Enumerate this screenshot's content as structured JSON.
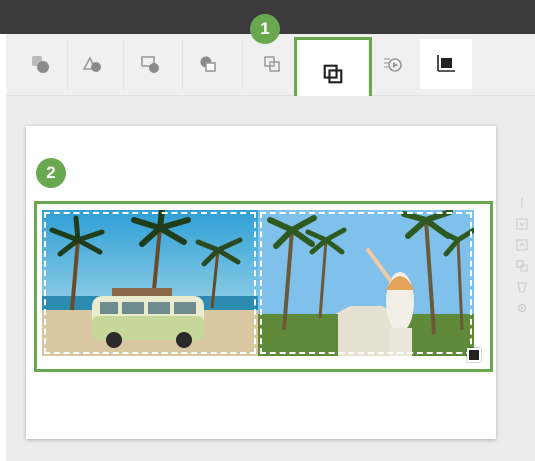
{
  "toolbar": {
    "tools": [
      {
        "name": "arrange-icon"
      },
      {
        "name": "shape-icon"
      },
      {
        "name": "layer-icon"
      },
      {
        "name": "overlap-icon"
      },
      {
        "name": "frame-icon"
      },
      {
        "name": "group-icon"
      },
      {
        "name": "effect-icon"
      },
      {
        "name": "crop-icon"
      }
    ]
  },
  "callouts": {
    "step1": "1",
    "step2": "2"
  },
  "colors": {
    "accent": "#6aa84f",
    "topbar": "#3b3b3b",
    "toolbar": "#f0f0f0"
  }
}
